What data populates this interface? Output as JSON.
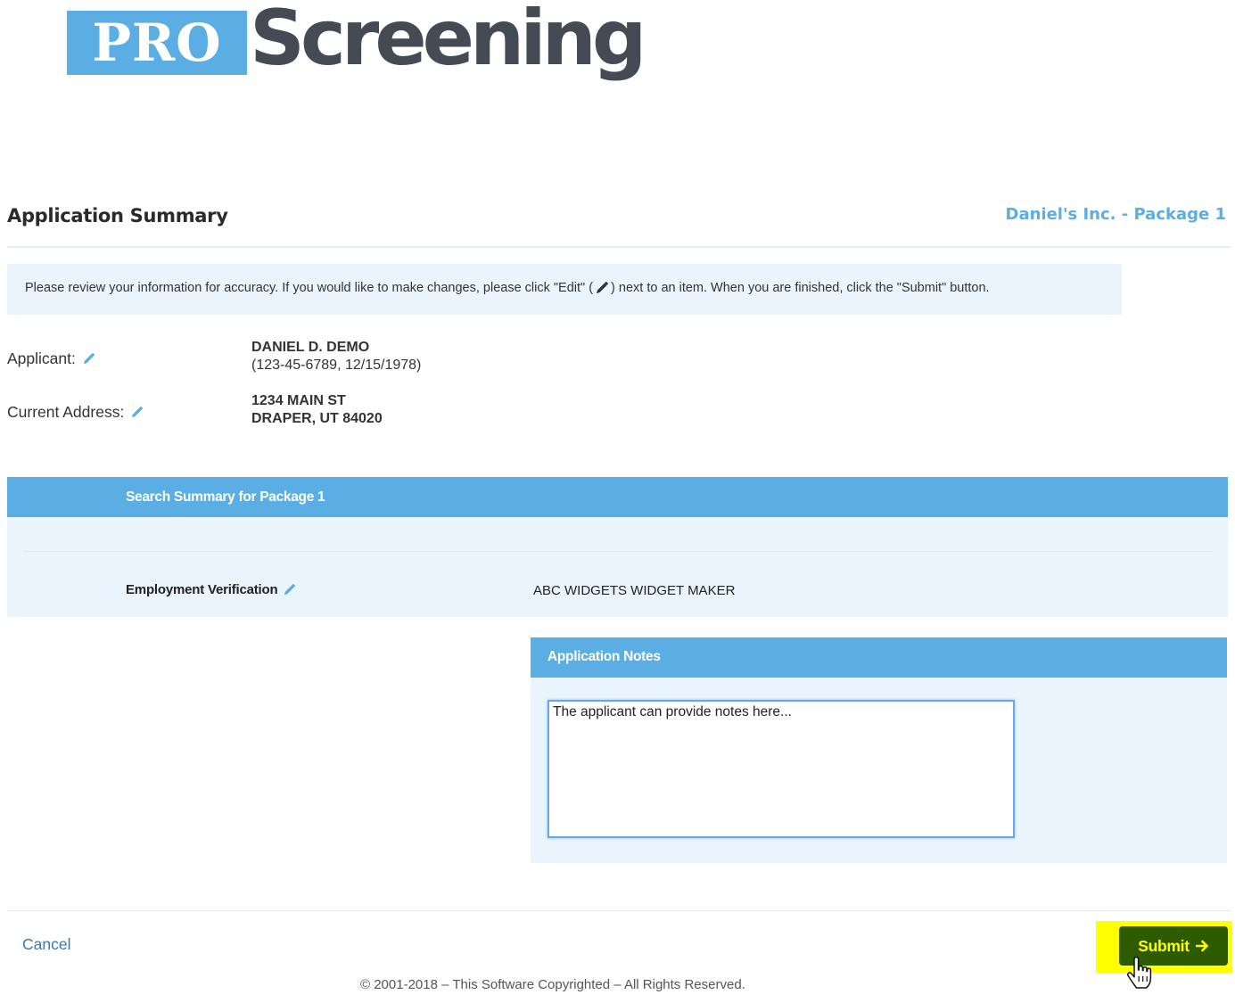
{
  "logo": {
    "pro": "PRO",
    "screening": "Screening"
  },
  "header": {
    "title": "Application Summary",
    "package_name": "Daniel's Inc. - Package 1"
  },
  "info_banner": {
    "text_before_icon": "Please review your information for accuracy. If you would like to make changes, please click \"Edit\" (",
    "text_after_icon": ") next to an item. When you are finished, click the \"Submit\" button."
  },
  "applicant": {
    "label": "Applicant:",
    "name": "DANIEL D. DEMO",
    "details": "(123-45-6789, 12/15/1978)"
  },
  "address": {
    "label": "Current Address:",
    "line1": "1234 MAIN ST",
    "line2": "DRAPER, UT 84020"
  },
  "search_summary": {
    "title": "Search Summary for Package 1",
    "items": [
      {
        "label": "Employment Verification",
        "value": "ABC WIDGETS WIDGET MAKER"
      }
    ]
  },
  "notes": {
    "title": "Application Notes",
    "value": "The applicant can provide notes here..."
  },
  "footer": {
    "cancel_label": "Cancel",
    "submit_label": "Submit",
    "copyright": "© 2001-2018 – This Software Copyrighted – All Rights Reserved."
  },
  "colors": {
    "brand_blue": "#5aaee3",
    "panel_bg": "#e9f4fc",
    "submit_bg": "#2f5b00",
    "submit_text": "#ffff00",
    "highlight": "#ffff00",
    "link": "#3679b5"
  },
  "icons": {
    "edit": "pencil-icon",
    "submit_arrow": "arrow-right-icon",
    "cursor": "hand-pointer-icon"
  }
}
